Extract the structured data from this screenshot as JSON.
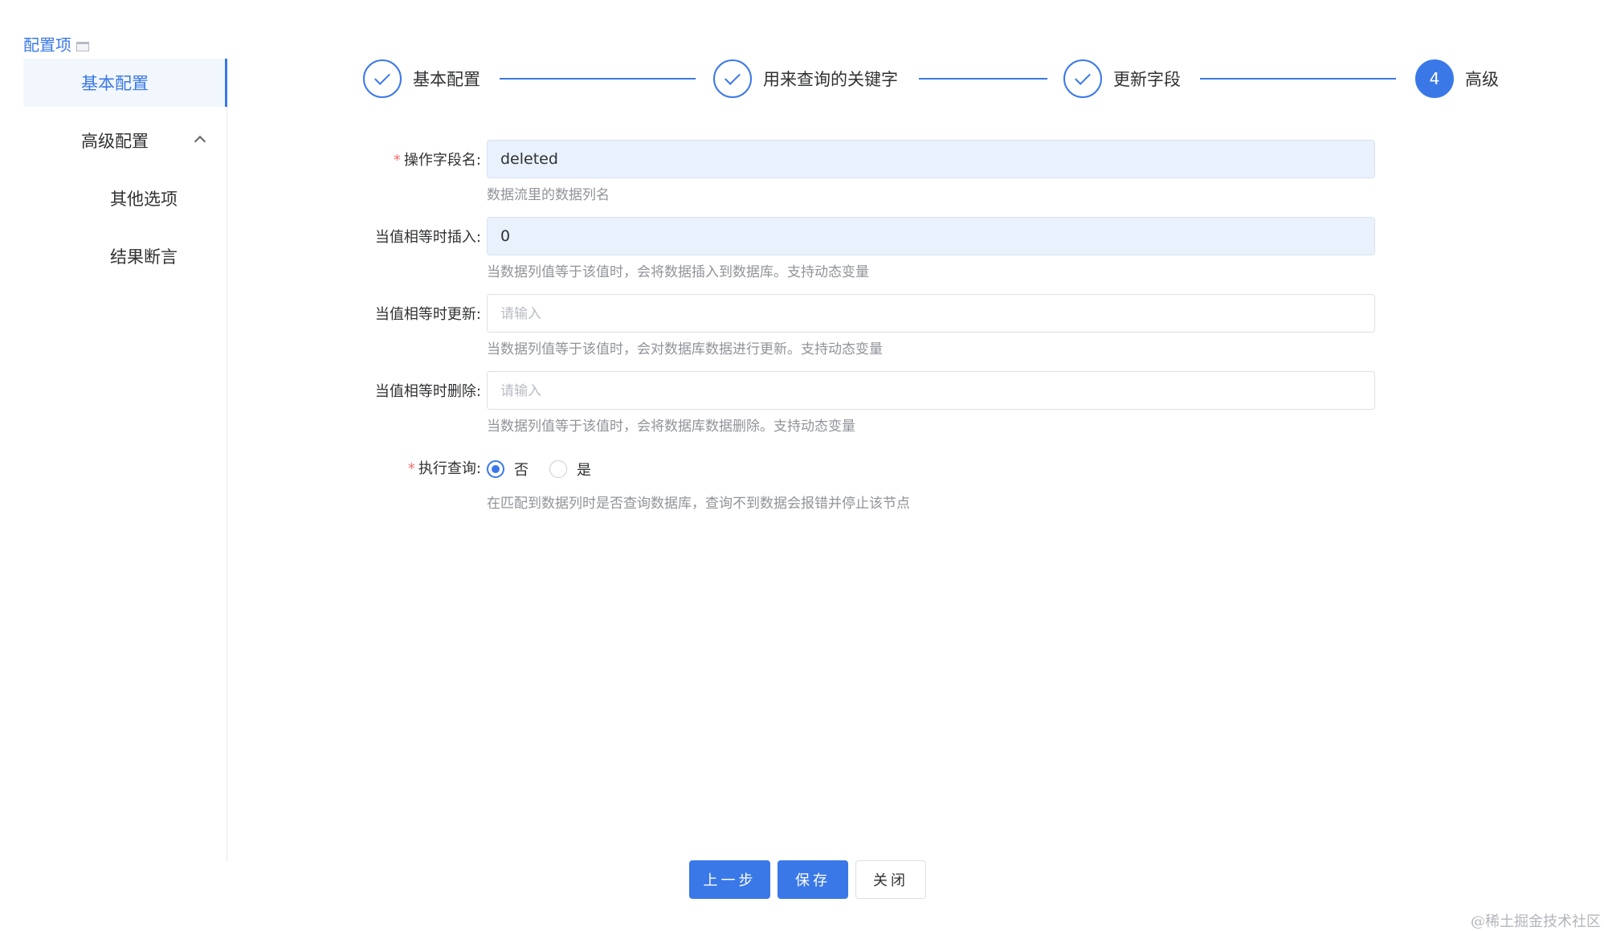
{
  "sidebar": {
    "title": "配置项",
    "items": [
      {
        "label": "基本配置",
        "active": true
      },
      {
        "label": "高级配置",
        "expanded": true
      },
      {
        "label": "其他选项"
      },
      {
        "label": "结果断言"
      }
    ]
  },
  "steps": [
    {
      "label": "基本配置",
      "status": "finished"
    },
    {
      "label": "用来查询的关键字",
      "status": "finished"
    },
    {
      "label": "更新字段",
      "status": "finished"
    },
    {
      "label": "高级",
      "number": "4",
      "status": "current"
    }
  ],
  "form": {
    "field_name": {
      "label": "操作字段名:",
      "required": true,
      "value": "deleted",
      "hint": "数据流里的数据列名"
    },
    "insert_value": {
      "label": "当值相等时插入:",
      "value": "0",
      "hint": "当数据列值等于该值时，会将数据插入到数据库。支持动态变量"
    },
    "update_value": {
      "label": "当值相等时更新:",
      "placeholder": "请输入",
      "hint": "当数据列值等于该值时，会对数据库数据进行更新。支持动态变量"
    },
    "delete_value": {
      "label": "当值相等时删除:",
      "placeholder": "请输入",
      "hint": "当数据列值等于该值时，会将数据库数据删除。支持动态变量"
    },
    "execute_query": {
      "label": "执行查询:",
      "required": true,
      "options": [
        {
          "label": "否",
          "selected": true
        },
        {
          "label": "是",
          "selected": false
        }
      ],
      "hint": "在匹配到数据列时是否查询数据库，查询不到数据会报错并停止该节点"
    }
  },
  "buttons": {
    "prev": "上一步",
    "save": "保存",
    "close": "关闭"
  },
  "watermark": "@稀土掘金技术社区",
  "colors": {
    "accent": "#3a78e8",
    "required": "#f56c6c",
    "filled_input_bg": "#e9f1fd"
  }
}
